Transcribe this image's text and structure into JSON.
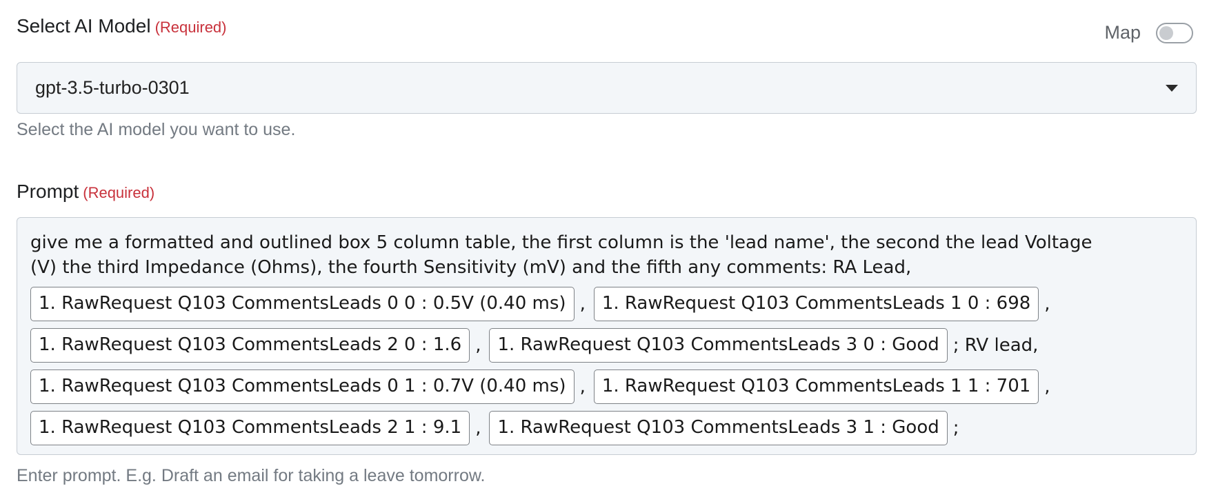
{
  "model_field": {
    "label": "Select AI Model",
    "required": "(Required)",
    "selected": "gpt-3.5-turbo-0301",
    "help": "Select the AI model you want to use."
  },
  "map_toggle": {
    "label": "Map",
    "enabled": false
  },
  "prompt_field": {
    "label": "Prompt",
    "required": "(Required)",
    "text_line1": "give me a formatted and outlined box 5 column table, the first column is the 'lead name', the second the lead Voltage",
    "text_line2": "(V) the third Impedance (Ohms), the fourth Sensitivity (mV) and the fifth any comments: RA Lead,",
    "chips": [
      "1. RawRequest Q103 CommentsLeads 0 0 : 0.5V (0.40 ms)",
      "1. RawRequest Q103 CommentsLeads 1 0 : 698",
      "1. RawRequest Q103 CommentsLeads 2 0 : 1.6",
      "1. RawRequest Q103 CommentsLeads 3 0 : Good",
      "1. RawRequest Q103 CommentsLeads 0 1 : 0.7V (0.40 ms)",
      "1. RawRequest Q103 CommentsLeads 1 1 : 701",
      "1. RawRequest Q103 CommentsLeads 2 1 : 9.1",
      "1. RawRequest Q103 CommentsLeads 3 1 : Good"
    ],
    "separators": {
      "comma": ",",
      "rv": "; RV lead,",
      "end": ";"
    },
    "help": "Enter prompt. E.g. Draft an email for taking a leave tomorrow."
  }
}
